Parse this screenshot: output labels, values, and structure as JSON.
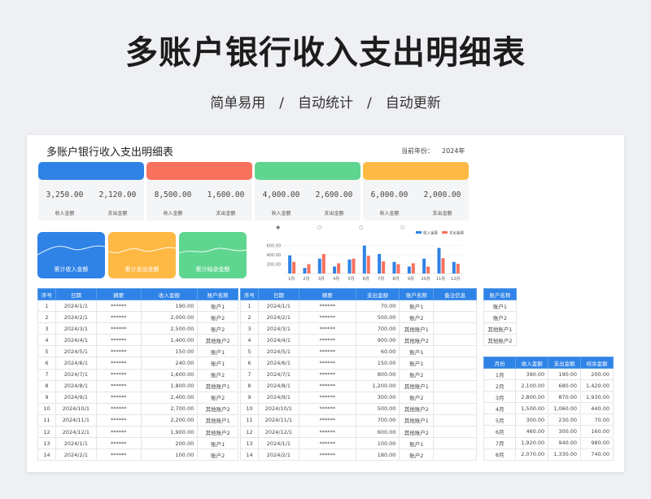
{
  "hero": {
    "title": "多账户银行收入支出明细表",
    "subtitle": "简单易用　/　自动统计　/　自动更新"
  },
  "sheet": {
    "title": "多账户银行收入支出明细表",
    "year_label": "当前年份：",
    "year_value": "2024年"
  },
  "cards": [
    {
      "color": "#2f83e6",
      "income": "3,250.00",
      "expense": "2,120.00"
    },
    {
      "color": "#f7715d",
      "income": "8,500.00",
      "expense": "1,600.00"
    },
    {
      "color": "#5fd68f",
      "income": "4,000.00",
      "expense": "2,600.00"
    },
    {
      "color": "#fdb944",
      "income": "6,000.00",
      "expense": "2,000.00"
    }
  ],
  "card_labels": {
    "income": "收入金额",
    "expense": "支出金额"
  },
  "tiles": [
    {
      "label": "累计收入金额",
      "color": "#2f83e6"
    },
    {
      "label": "累计支出金额",
      "color": "#fdb944"
    },
    {
      "label": "累计结余金额",
      "color": "#5fd68f"
    }
  ],
  "chart_data": {
    "type": "bar",
    "categories": [
      "1月",
      "2月",
      "3月",
      "4月",
      "5月",
      "6月",
      "7月",
      "8月",
      "9月",
      "10月",
      "11月",
      "12月"
    ],
    "series": [
      {
        "name": "收入金额",
        "color": "#2f83e6",
        "values": [
          390,
          120,
          320,
          150,
          300,
          600,
          420,
          250,
          150,
          320,
          550,
          250
        ]
      },
      {
        "name": "支出金额",
        "color": "#f7715d",
        "values": [
          250,
          200,
          420,
          220,
          320,
          380,
          260,
          200,
          220,
          150,
          330,
          210
        ]
      }
    ],
    "yticks": [
      "600.00",
      "400.00",
      "200.00"
    ],
    "ylim": [
      0,
      700
    ],
    "legend": "top-right"
  },
  "income_table": {
    "headers": [
      "序号",
      "日期",
      "摘要",
      "收入金额",
      "账户名称"
    ],
    "rows": [
      [
        "1",
        "2024/1/1",
        "******",
        "190.00",
        "账户1"
      ],
      [
        "2",
        "2024/2/1",
        "******",
        "2,000.00",
        "账户2"
      ],
      [
        "3",
        "2024/3/1",
        "******",
        "2,500.00",
        "账户2"
      ],
      [
        "4",
        "2024/4/1",
        "******",
        "1,400.00",
        "其他账户2"
      ],
      [
        "5",
        "2024/5/1",
        "******",
        "150.00",
        "账户1"
      ],
      [
        "6",
        "2024/6/1",
        "******",
        "240.00",
        "账户1"
      ],
      [
        "7",
        "2024/7/1",
        "******",
        "1,600.00",
        "账户2"
      ],
      [
        "8",
        "2024/8/1",
        "******",
        "1,800.00",
        "其他账户1"
      ],
      [
        "9",
        "2024/9/1",
        "******",
        "2,400.00",
        "账户2"
      ],
      [
        "10",
        "2024/10/1",
        "******",
        "2,700.00",
        "其他账户2"
      ],
      [
        "11",
        "2024/11/1",
        "******",
        "2,200.00",
        "其他账户1"
      ],
      [
        "12",
        "2024/12/1",
        "******",
        "1,900.00",
        "其他账户2"
      ],
      [
        "13",
        "2024/1/1",
        "******",
        "200.00",
        "账户1"
      ],
      [
        "14",
        "2024/2/1",
        "******",
        "100.00",
        "账户2"
      ]
    ]
  },
  "expense_table": {
    "headers": [
      "序号",
      "日期",
      "摘要",
      "支出金额",
      "账户名称",
      "备注信息"
    ],
    "rows": [
      [
        "1",
        "2024/1/1",
        "******",
        "70.00",
        "账户1",
        ""
      ],
      [
        "2",
        "2024/2/1",
        "******",
        "500.00",
        "账户2",
        ""
      ],
      [
        "3",
        "2024/3/1",
        "******",
        "700.00",
        "其他账户1",
        ""
      ],
      [
        "4",
        "2024/4/1",
        "******",
        "900.00",
        "其他账户2",
        ""
      ],
      [
        "5",
        "2024/5/1",
        "******",
        "60.00",
        "账户1",
        ""
      ],
      [
        "6",
        "2024/6/1",
        "******",
        "150.00",
        "账户1",
        ""
      ],
      [
        "7",
        "2024/7/1",
        "******",
        "800.00",
        "账户2",
        ""
      ],
      [
        "8",
        "2024/8/1",
        "******",
        "1,200.00",
        "其他账户1",
        ""
      ],
      [
        "9",
        "2024/9/1",
        "******",
        "300.00",
        "账户2",
        ""
      ],
      [
        "10",
        "2024/10/1",
        "******",
        "500.00",
        "其他账户2",
        ""
      ],
      [
        "11",
        "2024/11/1",
        "******",
        "700.00",
        "其他账户1",
        ""
      ],
      [
        "12",
        "2024/12/1",
        "******",
        "600.00",
        "其他账户2",
        ""
      ],
      [
        "13",
        "2024/1/1",
        "******",
        "100.00",
        "账户1",
        ""
      ],
      [
        "14",
        "2024/2/1",
        "******",
        "180.00",
        "账户2",
        ""
      ]
    ]
  },
  "account_table": {
    "header": "账户名称",
    "rows": [
      "账户1",
      "账户2",
      "其他账户1",
      "其他账户2"
    ]
  },
  "month_table": {
    "headers": [
      "月份",
      "收入金额",
      "支出金额",
      "结余金额"
    ],
    "rows": [
      [
        "1月",
        "390.00",
        "190.00",
        "200.00"
      ],
      [
        "2月",
        "2,100.00",
        "680.00",
        "1,420.00"
      ],
      [
        "3月",
        "2,800.00",
        "870.00",
        "1,930.00"
      ],
      [
        "4月",
        "1,500.00",
        "1,060.00",
        "440.00"
      ],
      [
        "5月",
        "300.00",
        "230.00",
        "70.00"
      ],
      [
        "6月",
        "460.00",
        "300.00",
        "160.00"
      ],
      [
        "7月",
        "1,920.00",
        "940.00",
        "980.00"
      ],
      [
        "8月",
        "2,070.00",
        "1,330.00",
        "740.00"
      ]
    ]
  }
}
